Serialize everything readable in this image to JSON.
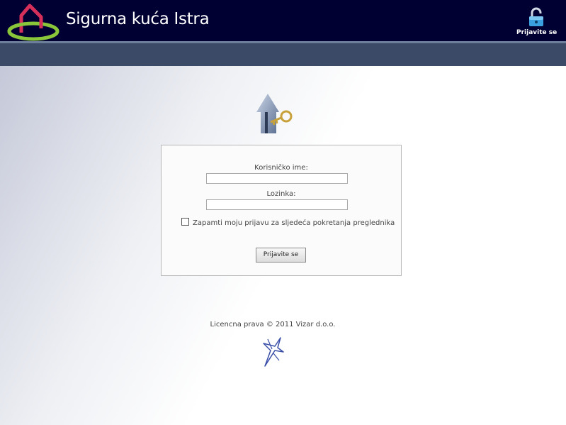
{
  "header": {
    "brand_name": "Sigurna kuća Istra",
    "login_label": "Prijavite se",
    "login_icon": "unlocked-padlock-icon",
    "logo_icon": "house-ellipse-logo",
    "colors": {
      "background": "#000033",
      "logo_red": "#d6305a",
      "logo_green": "#8ac63a",
      "padlock": "#3aa0e0"
    }
  },
  "navbar": {
    "color": "#3b4a66"
  },
  "login_form": {
    "illustration": "house-key-icon",
    "username_label": "Korisničko ime:",
    "username_value": "",
    "password_label": "Lozinka:",
    "password_value": "",
    "remember_label": "Zapamti moju prijavu za sljedeća pokretanja preglednika",
    "remember_checked": false,
    "submit_label": "Prijavite se"
  },
  "footer": {
    "copyright": "Licencna prava © 2011 Vizar d.o.o.",
    "logo_icon": "vizar-star-logo"
  }
}
